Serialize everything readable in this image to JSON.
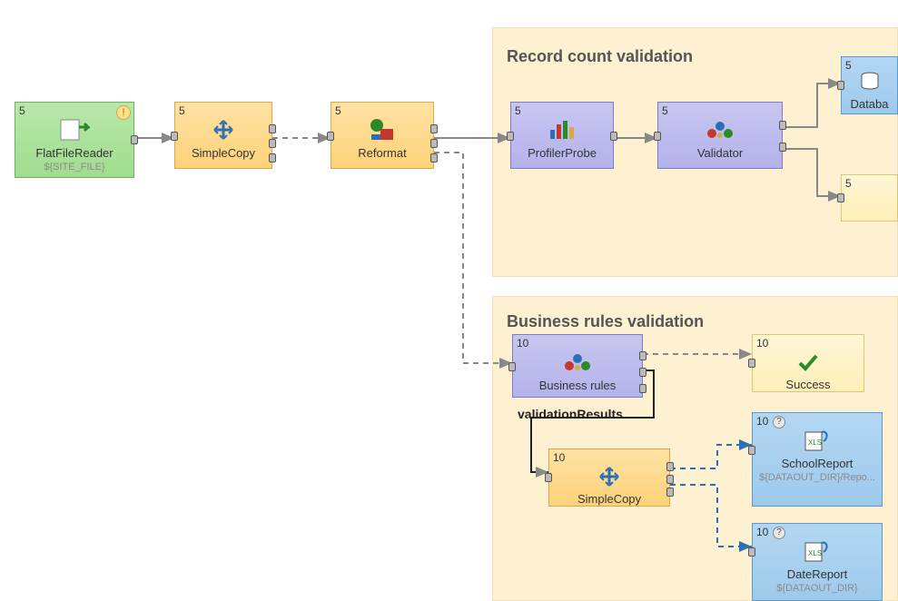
{
  "groups": {
    "record": {
      "title": "Record count validation"
    },
    "business": {
      "title": "Business rules validation"
    }
  },
  "nodes": {
    "flatfile": {
      "num": "5",
      "label": "FlatFileReader",
      "sublabel": "${SITE_FILE}"
    },
    "simplecopy1": {
      "num": "5",
      "label": "SimpleCopy"
    },
    "reformat": {
      "num": "5",
      "label": "Reformat"
    },
    "profiler": {
      "num": "5",
      "label": "ProfilerProbe"
    },
    "validator": {
      "num": "5",
      "label": "Validator"
    },
    "dbtop": {
      "num": "5",
      "label": "Databa"
    },
    "palebox": {
      "num": "5",
      "label": ""
    },
    "bizrules": {
      "num": "10",
      "label": "Business rules"
    },
    "success": {
      "num": "10",
      "label": "Success"
    },
    "simplecopy2": {
      "num": "10",
      "label": "SimpleCopy"
    },
    "school": {
      "num": "10",
      "label": "SchoolReport",
      "sublabel": "${DATAOUT_DIR}/Repo..."
    },
    "datereport": {
      "num": "10",
      "label": "DateReport",
      "sublabel": "${DATAOUT_DIR}"
    }
  },
  "edges": {
    "validationResults": "validationResults"
  },
  "colors": {
    "solid": "#888",
    "dashed": "#888",
    "blue": "#2a6fb5"
  }
}
